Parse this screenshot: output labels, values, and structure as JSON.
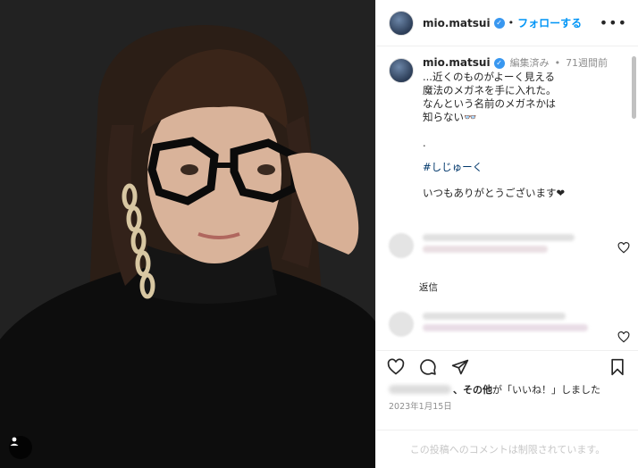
{
  "post": {
    "username": "mio.matsui",
    "header_separator": "•",
    "follow_label": "フォローする",
    "more_label": "•••"
  },
  "caption": {
    "username": "mio.matsui",
    "edited_label": "編集済み",
    "separator": "•",
    "time_ago": "71週間前",
    "text": "...近くのものがよーく見える\n魔法のメガネを手に入れた。\nなんという名前のメガネかは\n知らない👓",
    "dot_line": ".",
    "hashtag": "#しじゅーく",
    "thanks": "いつもありがとうございます❤"
  },
  "comments": {
    "reply_label": "返信"
  },
  "likes": {
    "and_others": "、その他",
    "suffix": "が「いいね！」しました"
  },
  "date": "2023年1月15日",
  "restricted_notice": "この投稿へのコメントは制限されています。",
  "colors": {
    "accent": "#0095f6",
    "verified": "#3897f0",
    "hashtag": "#00376b",
    "muted": "#8e8e8e"
  },
  "icons": {
    "photo_tag": "person-tag-icon",
    "like": "heart-icon",
    "comment": "comment-bubble-icon",
    "share": "paper-plane-icon",
    "save": "bookmark-icon"
  }
}
